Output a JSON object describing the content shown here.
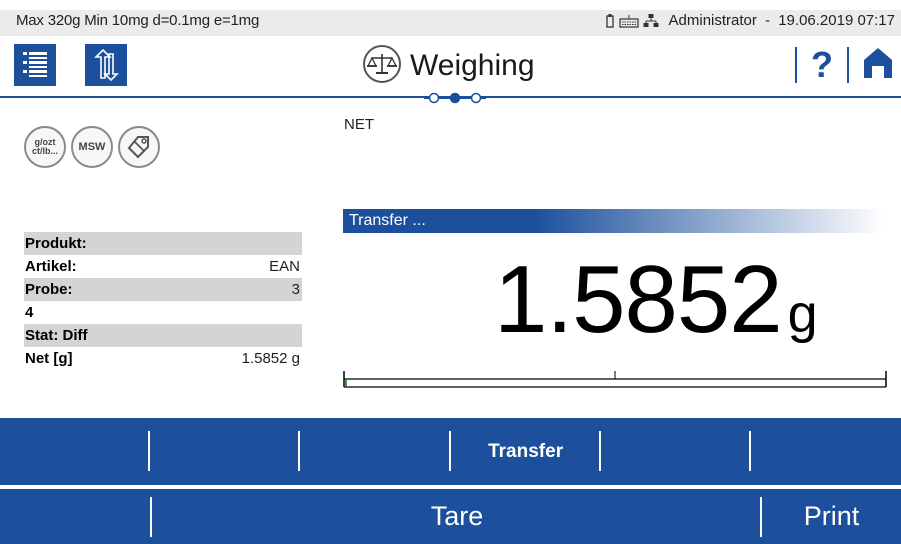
{
  "status_bar": {
    "specs": "Max 320g  Min 10mg  d=0.1mg  e=1mg",
    "user": "Administrator",
    "separator": " - ",
    "datetime": "19.06.2019 07:17",
    "icons": [
      "usb-icon",
      "keyboard-icon",
      "network-icon"
    ]
  },
  "header": {
    "title": "Weighing",
    "title_icon": "balance-scale-icon",
    "help_label": "?",
    "page_indicator": {
      "pages": 3,
      "active": 2
    }
  },
  "function_icons": [
    {
      "name": "unit-switch-icon",
      "label_top": "g/ozt",
      "label_bottom": "ct/lb..."
    },
    {
      "name": "msw-icon",
      "label": "MSW"
    },
    {
      "name": "tag-icon",
      "label": ""
    }
  ],
  "net_label": "NET",
  "info_table": {
    "rows": [
      {
        "label": "Produkt:",
        "value": "",
        "shaded": true
      },
      {
        "label": "Artikel:",
        "value": "EAN",
        "shaded": false
      },
      {
        "label": "Probe:",
        "value": "3",
        "shaded": true
      },
      {
        "label": "4",
        "value": "",
        "shaded": false
      },
      {
        "label": "Stat: Diff",
        "value": "",
        "shaded": true
      },
      {
        "label": "Net [g]",
        "value": "1.5852 g",
        "shaded": false
      }
    ]
  },
  "transfer_bar": {
    "label": "Transfer ..."
  },
  "weight": {
    "value": "1.5852",
    "unit": "g"
  },
  "progress": {
    "fill_fraction": 0.0
  },
  "softkeys_top": [
    "",
    "",
    "",
    "Transfer",
    "",
    ""
  ],
  "softkeys_bottom": {
    "tare": "Tare",
    "print": "Print"
  },
  "colors": {
    "accent": "#1c4f9c",
    "shaded_row": "#d4d4d4",
    "statusbar": "#ebebeb"
  }
}
